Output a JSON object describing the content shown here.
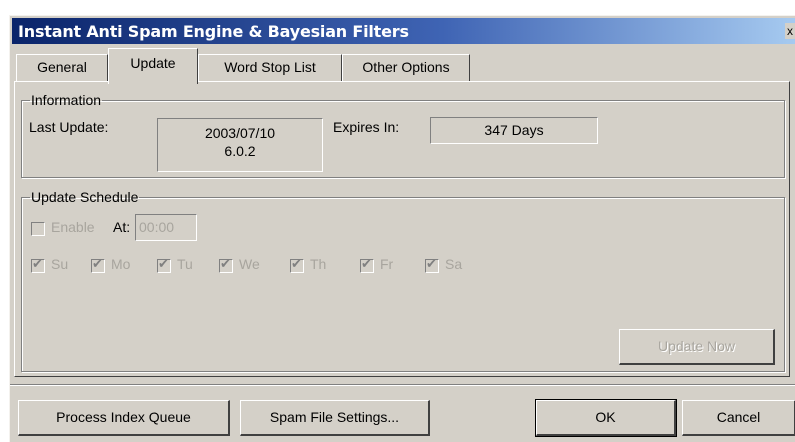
{
  "window": {
    "title": "Instant Anti Spam Engine & Bayesian Filters",
    "close_glyph": "x"
  },
  "tabs": [
    {
      "label": "General",
      "active": false
    },
    {
      "label": "Update",
      "active": true
    },
    {
      "label": "Word Stop List",
      "active": false
    },
    {
      "label": "Other Options",
      "active": false
    }
  ],
  "information": {
    "legend": "Information",
    "last_update_label": "Last Update:",
    "last_update_date": "2003/07/10",
    "last_update_version": "6.0.2",
    "expires_label": "Expires In:",
    "expires_value": "347 Days"
  },
  "schedule": {
    "legend": "Update Schedule",
    "enable_label": "Enable",
    "enable_checked": false,
    "at_label": "At:",
    "time_value": "00:00",
    "days": [
      {
        "label": "Su",
        "checked": true
      },
      {
        "label": "Mo",
        "checked": true
      },
      {
        "label": "Tu",
        "checked": true
      },
      {
        "label": "We",
        "checked": true
      },
      {
        "label": "Th",
        "checked": true
      },
      {
        "label": "Fr",
        "checked": true
      },
      {
        "label": "Sa",
        "checked": true
      }
    ],
    "update_now_label": "Update Now"
  },
  "buttons": {
    "process_queue_label": "Process Index Queue",
    "spam_settings_label": "Spam File Settings...",
    "ok_label": "OK",
    "cancel_label": "Cancel"
  },
  "colors": {
    "title_gradient_start": "#0a246a",
    "title_gradient_end": "#a6caf0",
    "face": "#d4d0c8",
    "disabled_text": "#a8a59e"
  }
}
